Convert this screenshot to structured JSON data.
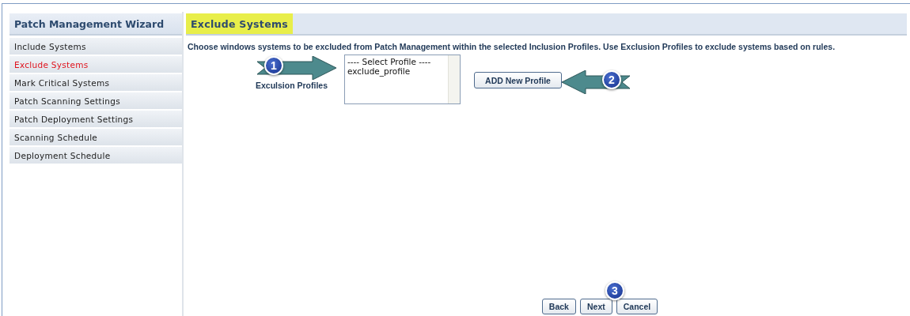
{
  "sidebar": {
    "title": "Patch Management Wizard",
    "steps": [
      {
        "label": "Include Systems",
        "selected": false
      },
      {
        "label": "Exclude Systems",
        "selected": true
      },
      {
        "label": "Mark Critical Systems",
        "selected": false
      },
      {
        "label": "Patch Scanning Settings",
        "selected": false
      },
      {
        "label": "Patch Deployment Settings",
        "selected": false
      },
      {
        "label": "Scanning Schedule",
        "selected": false
      },
      {
        "label": "Deployment Schedule",
        "selected": false
      }
    ]
  },
  "main": {
    "title": "Exclude Systems",
    "description": "Choose windows systems to be excluded from Patch Management within the selected Inclusion Profiles. Use Exclusion Profiles to exclude systems based on rules.",
    "profiles": {
      "label": "Exculsion Profiles",
      "options": [
        "---- Select Profile ----",
        "exclude_profile"
      ]
    },
    "add_button": "ADD New Profile",
    "callouts": [
      "1",
      "2",
      "3"
    ],
    "buttons": [
      "Back",
      "Next",
      "Cancel"
    ]
  }
}
